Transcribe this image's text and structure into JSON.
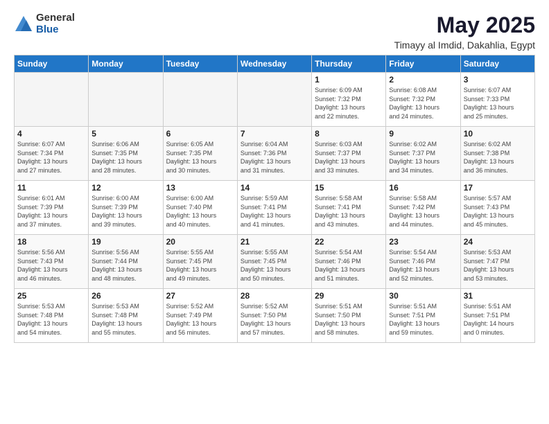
{
  "logo": {
    "general": "General",
    "blue": "Blue"
  },
  "title": "May 2025",
  "subtitle": "Timayy al Imdid, Dakahlia, Egypt",
  "weekdays": [
    "Sunday",
    "Monday",
    "Tuesday",
    "Wednesday",
    "Thursday",
    "Friday",
    "Saturday"
  ],
  "weeks": [
    [
      {
        "day": "",
        "info": ""
      },
      {
        "day": "",
        "info": ""
      },
      {
        "day": "",
        "info": ""
      },
      {
        "day": "",
        "info": ""
      },
      {
        "day": "1",
        "info": "Sunrise: 6:09 AM\nSunset: 7:32 PM\nDaylight: 13 hours\nand 22 minutes."
      },
      {
        "day": "2",
        "info": "Sunrise: 6:08 AM\nSunset: 7:32 PM\nDaylight: 13 hours\nand 24 minutes."
      },
      {
        "day": "3",
        "info": "Sunrise: 6:07 AM\nSunset: 7:33 PM\nDaylight: 13 hours\nand 25 minutes."
      }
    ],
    [
      {
        "day": "4",
        "info": "Sunrise: 6:07 AM\nSunset: 7:34 PM\nDaylight: 13 hours\nand 27 minutes."
      },
      {
        "day": "5",
        "info": "Sunrise: 6:06 AM\nSunset: 7:35 PM\nDaylight: 13 hours\nand 28 minutes."
      },
      {
        "day": "6",
        "info": "Sunrise: 6:05 AM\nSunset: 7:35 PM\nDaylight: 13 hours\nand 30 minutes."
      },
      {
        "day": "7",
        "info": "Sunrise: 6:04 AM\nSunset: 7:36 PM\nDaylight: 13 hours\nand 31 minutes."
      },
      {
        "day": "8",
        "info": "Sunrise: 6:03 AM\nSunset: 7:37 PM\nDaylight: 13 hours\nand 33 minutes."
      },
      {
        "day": "9",
        "info": "Sunrise: 6:02 AM\nSunset: 7:37 PM\nDaylight: 13 hours\nand 34 minutes."
      },
      {
        "day": "10",
        "info": "Sunrise: 6:02 AM\nSunset: 7:38 PM\nDaylight: 13 hours\nand 36 minutes."
      }
    ],
    [
      {
        "day": "11",
        "info": "Sunrise: 6:01 AM\nSunset: 7:39 PM\nDaylight: 13 hours\nand 37 minutes."
      },
      {
        "day": "12",
        "info": "Sunrise: 6:00 AM\nSunset: 7:39 PM\nDaylight: 13 hours\nand 39 minutes."
      },
      {
        "day": "13",
        "info": "Sunrise: 6:00 AM\nSunset: 7:40 PM\nDaylight: 13 hours\nand 40 minutes."
      },
      {
        "day": "14",
        "info": "Sunrise: 5:59 AM\nSunset: 7:41 PM\nDaylight: 13 hours\nand 41 minutes."
      },
      {
        "day": "15",
        "info": "Sunrise: 5:58 AM\nSunset: 7:41 PM\nDaylight: 13 hours\nand 43 minutes."
      },
      {
        "day": "16",
        "info": "Sunrise: 5:58 AM\nSunset: 7:42 PM\nDaylight: 13 hours\nand 44 minutes."
      },
      {
        "day": "17",
        "info": "Sunrise: 5:57 AM\nSunset: 7:43 PM\nDaylight: 13 hours\nand 45 minutes."
      }
    ],
    [
      {
        "day": "18",
        "info": "Sunrise: 5:56 AM\nSunset: 7:43 PM\nDaylight: 13 hours\nand 46 minutes."
      },
      {
        "day": "19",
        "info": "Sunrise: 5:56 AM\nSunset: 7:44 PM\nDaylight: 13 hours\nand 48 minutes."
      },
      {
        "day": "20",
        "info": "Sunrise: 5:55 AM\nSunset: 7:45 PM\nDaylight: 13 hours\nand 49 minutes."
      },
      {
        "day": "21",
        "info": "Sunrise: 5:55 AM\nSunset: 7:45 PM\nDaylight: 13 hours\nand 50 minutes."
      },
      {
        "day": "22",
        "info": "Sunrise: 5:54 AM\nSunset: 7:46 PM\nDaylight: 13 hours\nand 51 minutes."
      },
      {
        "day": "23",
        "info": "Sunrise: 5:54 AM\nSunset: 7:46 PM\nDaylight: 13 hours\nand 52 minutes."
      },
      {
        "day": "24",
        "info": "Sunrise: 5:53 AM\nSunset: 7:47 PM\nDaylight: 13 hours\nand 53 minutes."
      }
    ],
    [
      {
        "day": "25",
        "info": "Sunrise: 5:53 AM\nSunset: 7:48 PM\nDaylight: 13 hours\nand 54 minutes."
      },
      {
        "day": "26",
        "info": "Sunrise: 5:53 AM\nSunset: 7:48 PM\nDaylight: 13 hours\nand 55 minutes."
      },
      {
        "day": "27",
        "info": "Sunrise: 5:52 AM\nSunset: 7:49 PM\nDaylight: 13 hours\nand 56 minutes."
      },
      {
        "day": "28",
        "info": "Sunrise: 5:52 AM\nSunset: 7:50 PM\nDaylight: 13 hours\nand 57 minutes."
      },
      {
        "day": "29",
        "info": "Sunrise: 5:51 AM\nSunset: 7:50 PM\nDaylight: 13 hours\nand 58 minutes."
      },
      {
        "day": "30",
        "info": "Sunrise: 5:51 AM\nSunset: 7:51 PM\nDaylight: 13 hours\nand 59 minutes."
      },
      {
        "day": "31",
        "info": "Sunrise: 5:51 AM\nSunset: 7:51 PM\nDaylight: 14 hours\nand 0 minutes."
      }
    ]
  ]
}
